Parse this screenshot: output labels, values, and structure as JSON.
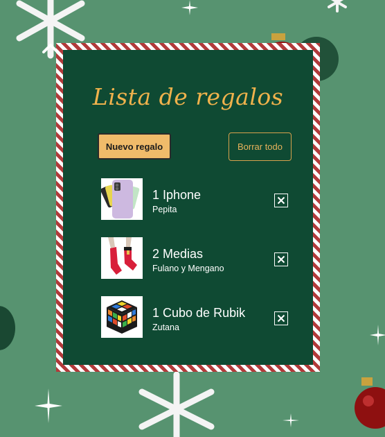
{
  "app": {
    "title": "Lista de regalos"
  },
  "toolbar": {
    "new_label": "Nuevo regalo",
    "clear_label": "Borrar todo"
  },
  "gifts": [
    {
      "title": "1 Iphone",
      "recipient": "Pepita",
      "image": "iphone-image"
    },
    {
      "title": "2 Medias",
      "recipient": "Fulano y Mengano",
      "image": "socks-image"
    },
    {
      "title": "1 Cubo de Rubik",
      "recipient": "Zutana",
      "image": "rubik-cube-image"
    }
  ],
  "icons": {
    "delete": "close-icon",
    "background": [
      "snowflake-icon",
      "ornament-icon",
      "sparkle-icon"
    ]
  },
  "colors": {
    "background": "#579370",
    "card": "#0f4a33",
    "accent": "#f0b24c",
    "stripe_red": "#b23a3a",
    "stripe_white": "#ffffff"
  }
}
